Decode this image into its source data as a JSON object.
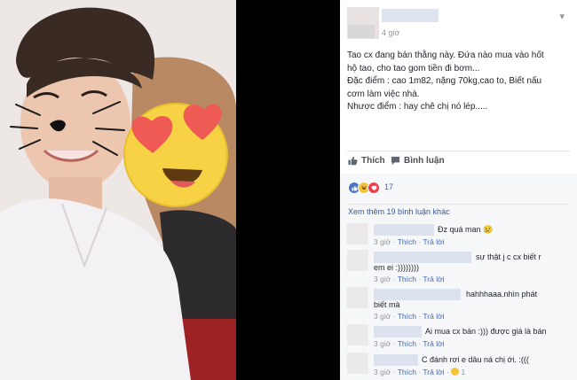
{
  "post": {
    "time": "4 giờ",
    "lines": [
      "Tao cx đang bán thằng này. Đứa nào mua vào hốt",
      "hộ tao, cho tao gom tiền đi bơm...",
      "Đặc điểm : cao 1m82, nặng 70kg,cao to, Biết nấu",
      "cơm làm việc nhà.",
      "Nhược điểm : hay chê chị nó lép....."
    ]
  },
  "actions": {
    "like": "Thích",
    "comment": "Bình luận"
  },
  "reactions": {
    "count": "17",
    "colors": [
      "#4a75c8",
      "#f5c33b",
      "#ee3e4b"
    ]
  },
  "comments": {
    "more": "Xem thêm 19 bình luận khác",
    "reply": "Trả lời",
    "sep": "·",
    "items": [
      {
        "text": "Đz quá man 😢",
        "time": "3 giờ"
      },
      {
        "text": "sự thật j c cx biết r",
        "text2": "em ei :))))))))",
        "time": "3 giờ"
      },
      {
        "text": "hahhhaaa.nhìn phát",
        "text2": "biết mà",
        "time": "3 giờ"
      },
      {
        "text": "Ai mua cx bán :))) được giá là bán",
        "time": "3 giờ"
      },
      {
        "text": "C đánh rơi e dâu ná chị ới. :(((",
        "time": "3 giờ",
        "reaction_count": "1"
      }
    ]
  }
}
